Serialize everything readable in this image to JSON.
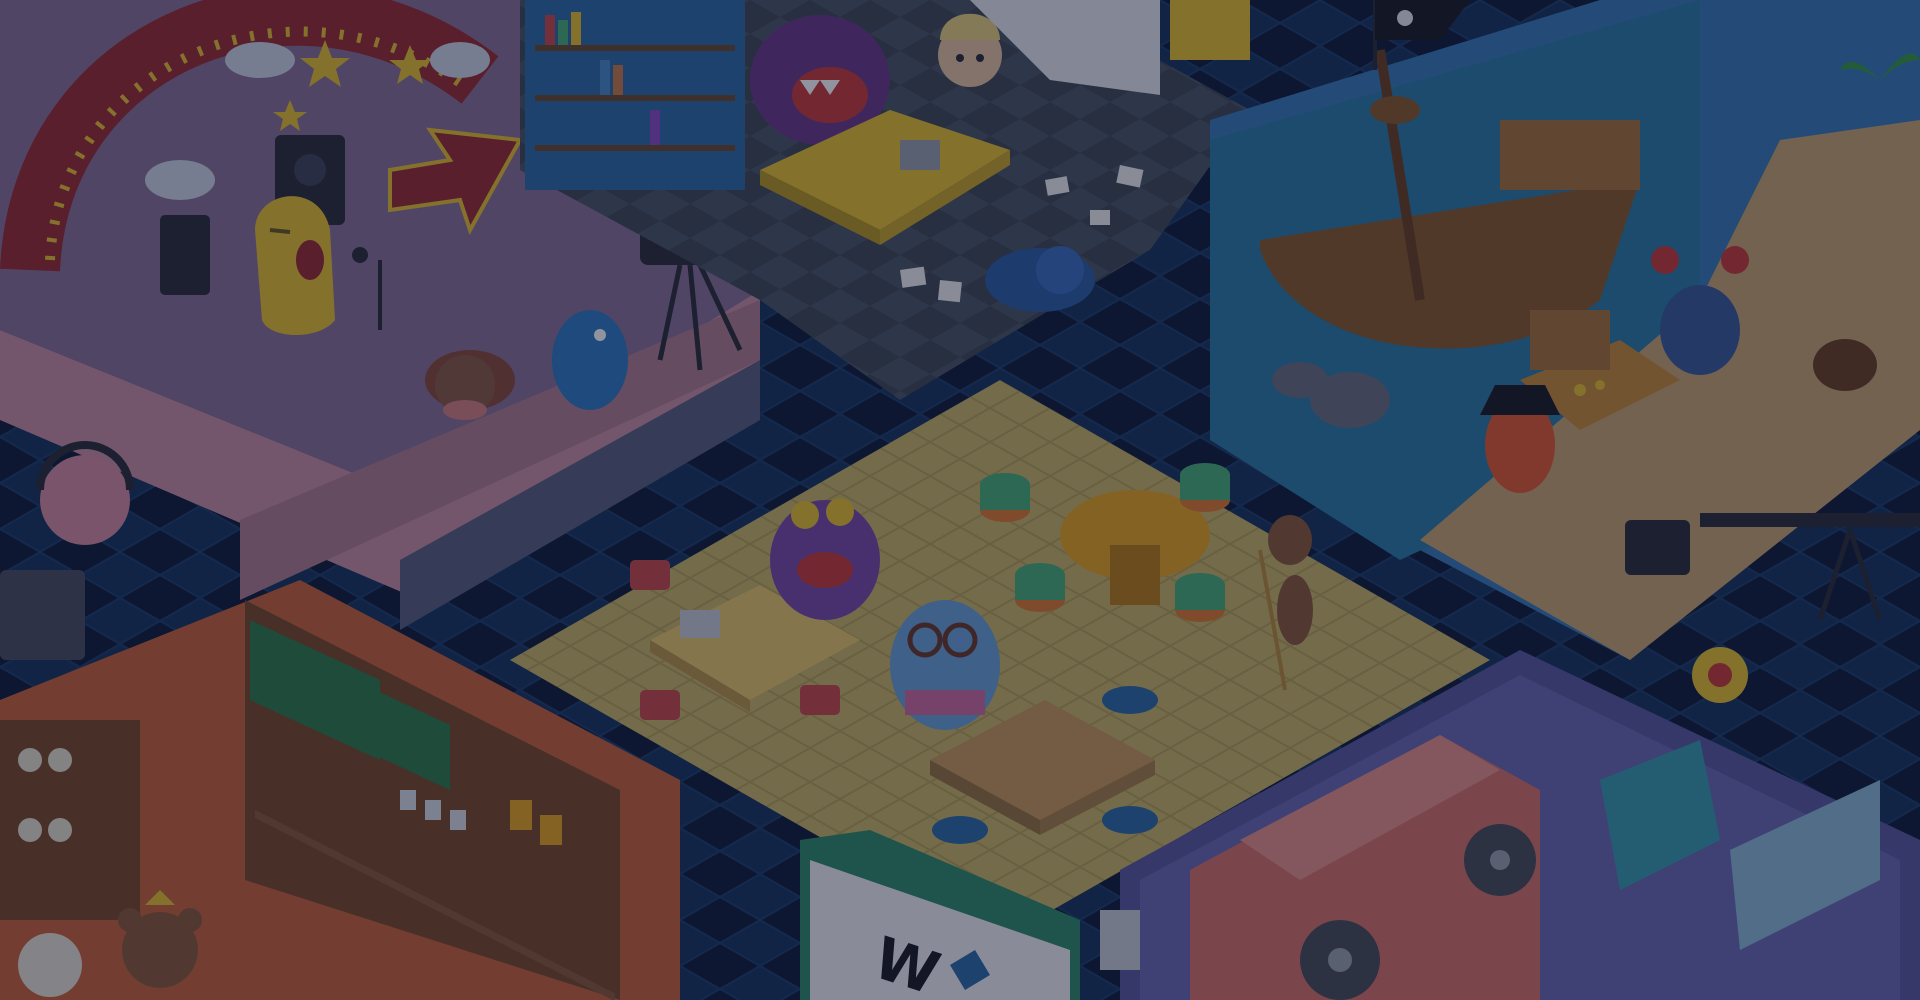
{
  "scene": {
    "studio_sign_text": "W",
    "colors": {
      "background": "#0f1d3a",
      "floor_tile": "#16335e",
      "stage_pink": "#c98fa4",
      "stage_red": "#8e1f2a",
      "office_floor": "#4b5666",
      "cafe_floor": "#c9b566",
      "pirate_sea": "#2a7aa8",
      "pirate_sand": "#c8a572",
      "shop_orange": "#c9633a",
      "machine_purple": "#5a58a0",
      "accent_yellow": "#e8c130"
    }
  }
}
